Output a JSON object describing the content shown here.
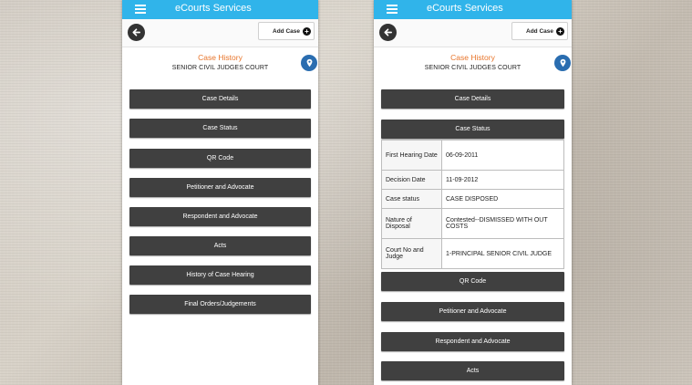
{
  "app": {
    "title": "eCourts Services",
    "add_case_label": "Add Case",
    "heading": "Case History",
    "court": "SENIOR CIVIL JUDGES COURT",
    "accent_color": "#30b4ea",
    "heading_color": "#e8752b"
  },
  "left_screen": {
    "buttons": [
      "Case Details",
      "Case Status",
      "QR Code",
      "Petitioner and Advocate",
      "Respondent and Advocate",
      "Acts",
      "History of Case Hearing",
      "Final Orders/Judgements"
    ]
  },
  "right_screen": {
    "buttons_top": [
      "Case Details",
      "Case Status"
    ],
    "case_status_table": [
      {
        "key": "First Hearing Date",
        "value": "06-09-2011"
      },
      {
        "key": "Decision Date",
        "value": "11-09-2012"
      },
      {
        "key": "Case status",
        "value": "CASE DISPOSED"
      },
      {
        "key": "Nature of Disposal",
        "value": "Contested--DISMISSED WITH OUT COSTS"
      },
      {
        "key": "Court No and Judge",
        "value": "1-PRINCIPAL SENIOR CIVIL JUDGE"
      }
    ],
    "buttons_bottom": [
      "QR Code",
      "Petitioner and Advocate",
      "Respondent and Advocate",
      "Acts"
    ]
  },
  "icons": {
    "menu": "hamburger-menu-icon",
    "back": "arrow-left-icon",
    "add": "plus-circle-icon",
    "map": "map-pin-icon"
  }
}
